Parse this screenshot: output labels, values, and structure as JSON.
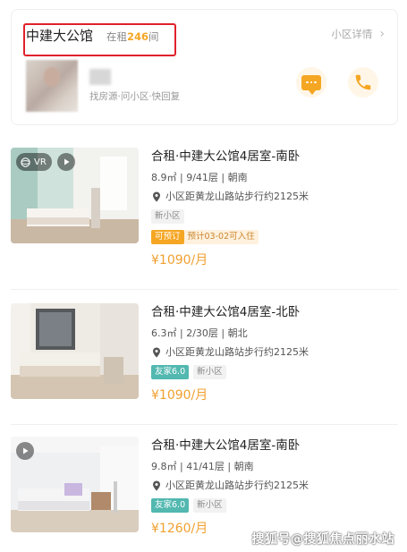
{
  "community": {
    "name": "中建大公馆",
    "rent_prefix": "在租",
    "rent_count": "246",
    "rent_suffix": "间",
    "detail_link": "小区详情",
    "agent_tags": "找房源·问小区·快回复"
  },
  "listings": [
    {
      "title": "合租·中建大公馆4居室-南卧",
      "meta": "8.9㎡ | 9/41层 | 朝南",
      "location": "小区距黄龙山路站步行约2125米",
      "badges": [
        "VR",
        "video"
      ],
      "tags": [
        {
          "text": "新小区",
          "style": "gray"
        }
      ],
      "extra_tags": [
        {
          "text": "可预订",
          "style": "orange"
        },
        {
          "text": "预计03-02可入住",
          "style": "peach"
        }
      ],
      "price": "¥1090/月"
    },
    {
      "title": "合租·中建大公馆4居室-北卧",
      "meta": "6.3㎡ | 2/30层 | 朝北",
      "location": "小区距黄龙山路站步行约2125米",
      "badges": [],
      "tags": [
        {
          "text": "友家6.0",
          "style": "teal"
        },
        {
          "text": "新小区",
          "style": "gray"
        }
      ],
      "price": "¥1090/月"
    },
    {
      "title": "合租·中建大公馆4居室-南卧",
      "meta": "9.8㎡ | 41/41层 | 朝南",
      "location": "小区距黄龙山路站步行约2125米",
      "badges": [
        "video"
      ],
      "tags": [
        {
          "text": "友家6.0",
          "style": "teal"
        },
        {
          "text": "新小区",
          "style": "gray"
        }
      ],
      "price": "¥1260/月"
    }
  ],
  "watermark": "搜狐号@搜狐焦点丽水站",
  "colors": {
    "accent": "#f5a623",
    "highlight_box": "#e0212b",
    "teal_tag": "#52b8b0"
  }
}
